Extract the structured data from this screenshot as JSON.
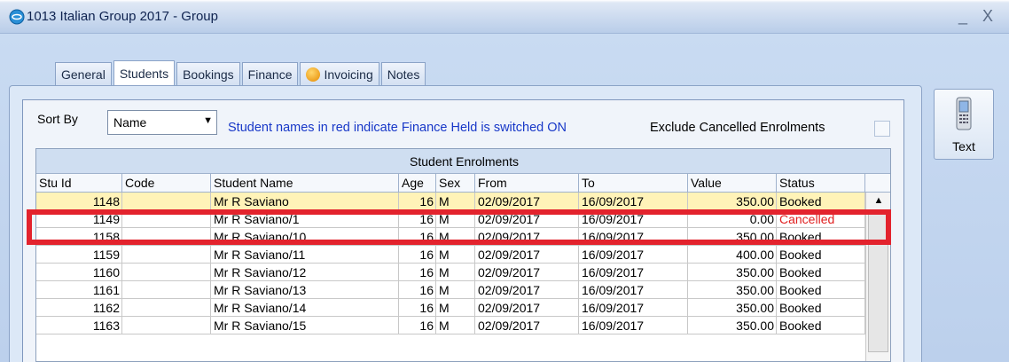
{
  "window": {
    "title": "1013 Italian Group 2017 - Group",
    "minimize_glyph": "_",
    "close_glyph": "X"
  },
  "tabs": [
    {
      "label": "General"
    },
    {
      "label": "Students",
      "active": true
    },
    {
      "label": "Bookings"
    },
    {
      "label": "Finance"
    },
    {
      "label": "Invoicing",
      "icon": "info-icon"
    },
    {
      "label": "Notes"
    }
  ],
  "toolbar": {
    "sort_label": "Sort By",
    "sort_value": "Name",
    "info_text": "Student names in red indicate Finance Held is switched ON",
    "exclude_label": "Exclude Cancelled Enrolments"
  },
  "side": {
    "text_button_label": "Text"
  },
  "grid": {
    "caption": "Student Enrolments",
    "columns": [
      "Stu Id",
      "Code",
      "Student Name",
      "Age",
      "Sex",
      "From",
      "To",
      "Value",
      "Status"
    ],
    "rows": [
      {
        "stu_id": "1148",
        "code": "",
        "name": "Mr R Saviano",
        "age": "16",
        "sex": "M",
        "from": "02/09/2017",
        "to": "16/09/2017",
        "value": "350.00",
        "status": "Booked"
      },
      {
        "stu_id": "1149",
        "code": "",
        "name": "Mr R Saviano/1",
        "age": "16",
        "sex": "M",
        "from": "02/09/2017",
        "to": "16/09/2017",
        "value": "0.00",
        "status": "Cancelled"
      },
      {
        "stu_id": "1158",
        "code": "",
        "name": "Mr R Saviano/10",
        "age": "16",
        "sex": "M",
        "from": "02/09/2017",
        "to": "16/09/2017",
        "value": "350.00",
        "status": "Booked"
      },
      {
        "stu_id": "1159",
        "code": "",
        "name": "Mr R Saviano/11",
        "age": "16",
        "sex": "M",
        "from": "02/09/2017",
        "to": "16/09/2017",
        "value": "400.00",
        "status": "Booked"
      },
      {
        "stu_id": "1160",
        "code": "",
        "name": "Mr R Saviano/12",
        "age": "16",
        "sex": "M",
        "from": "02/09/2017",
        "to": "16/09/2017",
        "value": "350.00",
        "status": "Booked"
      },
      {
        "stu_id": "1161",
        "code": "",
        "name": "Mr R Saviano/13",
        "age": "16",
        "sex": "M",
        "from": "02/09/2017",
        "to": "16/09/2017",
        "value": "350.00",
        "status": "Booked"
      },
      {
        "stu_id": "1162",
        "code": "",
        "name": "Mr R Saviano/14",
        "age": "16",
        "sex": "M",
        "from": "02/09/2017",
        "to": "16/09/2017",
        "value": "350.00",
        "status": "Booked"
      },
      {
        "stu_id": "1163",
        "code": "",
        "name": "Mr R Saviano/15",
        "age": "16",
        "sex": "M",
        "from": "02/09/2017",
        "to": "16/09/2017",
        "value": "350.00",
        "status": "Booked"
      }
    ]
  },
  "colors": {
    "cancelled_status": "#e02020",
    "info_text": "#1838c8",
    "selected_row": "#fff3b8",
    "highlight_box": "#e3232d"
  }
}
